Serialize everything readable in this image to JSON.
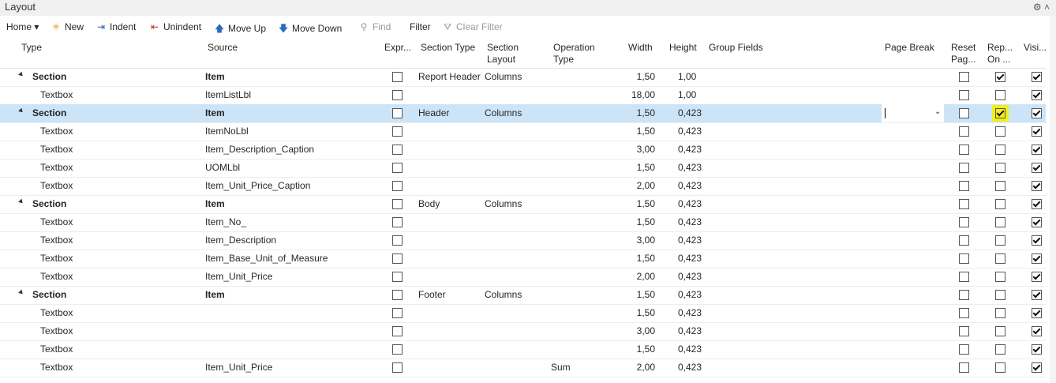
{
  "window": {
    "title": "Layout"
  },
  "toolbar": {
    "home": "Home",
    "new": "New",
    "indent": "Indent",
    "unindent": "Unindent",
    "move_up": "Move Up",
    "move_down": "Move Down",
    "find": "Find",
    "filter": "Filter",
    "clear_filter": "Clear Filter"
  },
  "columns": {
    "type": "Type",
    "source": "Source",
    "expr": "Expr...",
    "section_type": "Section Type",
    "section_layout": "Section Layout",
    "operation_type": "Operation Type",
    "width": "Width",
    "height": "Height",
    "group_fields": "Group Fields",
    "page_break": "Page Break",
    "reset_page": "Reset Pag...",
    "repeat_on": "Rep... On ...",
    "visible": "Visi..."
  },
  "rows": [
    {
      "type": "Section",
      "source": "Item",
      "section_type": "Report Header",
      "section_layout": "Columns",
      "operation_type": "",
      "width": "1,50",
      "height": "1,00",
      "expr": false,
      "reset": false,
      "repeat": true,
      "visible": true
    },
    {
      "type": "Textbox",
      "source": "ItemListLbl",
      "section_type": "",
      "section_layout": "",
      "operation_type": "",
      "width": "18,00",
      "height": "1,00",
      "expr": false,
      "reset": false,
      "repeat": false,
      "visible": true
    },
    {
      "type": "Section",
      "source": "Item",
      "section_type": "Header",
      "section_layout": "Columns",
      "operation_type": "",
      "width": "1,50",
      "height": "0,423",
      "expr": false,
      "reset": false,
      "repeat": true,
      "visible": true
    },
    {
      "type": "Textbox",
      "source": "ItemNoLbl",
      "section_type": "",
      "section_layout": "",
      "operation_type": "",
      "width": "1,50",
      "height": "0,423",
      "expr": false,
      "reset": false,
      "repeat": false,
      "visible": true
    },
    {
      "type": "Textbox",
      "source": "Item_Description_Caption",
      "section_type": "",
      "section_layout": "",
      "operation_type": "",
      "width": "3,00",
      "height": "0,423",
      "expr": false,
      "reset": false,
      "repeat": false,
      "visible": true
    },
    {
      "type": "Textbox",
      "source": "UOMLbl",
      "section_type": "",
      "section_layout": "",
      "operation_type": "",
      "width": "1,50",
      "height": "0,423",
      "expr": false,
      "reset": false,
      "repeat": false,
      "visible": true
    },
    {
      "type": "Textbox",
      "source": "Item_Unit_Price_Caption",
      "section_type": "",
      "section_layout": "",
      "operation_type": "",
      "width": "2,00",
      "height": "0,423",
      "expr": false,
      "reset": false,
      "repeat": false,
      "visible": true
    },
    {
      "type": "Section",
      "source": "Item",
      "section_type": "Body",
      "section_layout": "Columns",
      "operation_type": "",
      "width": "1,50",
      "height": "0,423",
      "expr": false,
      "reset": false,
      "repeat": false,
      "visible": true
    },
    {
      "type": "Textbox",
      "source": "Item_No_",
      "section_type": "",
      "section_layout": "",
      "operation_type": "",
      "width": "1,50",
      "height": "0,423",
      "expr": false,
      "reset": false,
      "repeat": false,
      "visible": true
    },
    {
      "type": "Textbox",
      "source": "Item_Description",
      "section_type": "",
      "section_layout": "",
      "operation_type": "",
      "width": "3,00",
      "height": "0,423",
      "expr": false,
      "reset": false,
      "repeat": false,
      "visible": true
    },
    {
      "type": "Textbox",
      "source": "Item_Base_Unit_of_Measure",
      "section_type": "",
      "section_layout": "",
      "operation_type": "",
      "width": "1,50",
      "height": "0,423",
      "expr": false,
      "reset": false,
      "repeat": false,
      "visible": true
    },
    {
      "type": "Textbox",
      "source": "Item_Unit_Price",
      "section_type": "",
      "section_layout": "",
      "operation_type": "",
      "width": "2,00",
      "height": "0,423",
      "expr": false,
      "reset": false,
      "repeat": false,
      "visible": true
    },
    {
      "type": "Section",
      "source": "Item",
      "section_type": "Footer",
      "section_layout": "Columns",
      "operation_type": "",
      "width": "1,50",
      "height": "0,423",
      "expr": false,
      "reset": false,
      "repeat": false,
      "visible": true
    },
    {
      "type": "Textbox",
      "source": "",
      "section_type": "",
      "section_layout": "",
      "operation_type": "",
      "width": "1,50",
      "height": "0,423",
      "expr": false,
      "reset": false,
      "repeat": false,
      "visible": true
    },
    {
      "type": "Textbox",
      "source": "",
      "section_type": "",
      "section_layout": "",
      "operation_type": "",
      "width": "3,00",
      "height": "0,423",
      "expr": false,
      "reset": false,
      "repeat": false,
      "visible": true
    },
    {
      "type": "Textbox",
      "source": "",
      "section_type": "",
      "section_layout": "",
      "operation_type": "",
      "width": "1,50",
      "height": "0,423",
      "expr": false,
      "reset": false,
      "repeat": false,
      "visible": true
    },
    {
      "type": "Textbox",
      "source": "Item_Unit_Price",
      "section_type": "",
      "section_layout": "",
      "operation_type": "Sum",
      "width": "2,00",
      "height": "0,423",
      "expr": false,
      "reset": false,
      "repeat": false,
      "visible": true
    }
  ],
  "selected_row": 2,
  "highlight_color": "#f2ef1a",
  "selection_color": "#cce4f7"
}
